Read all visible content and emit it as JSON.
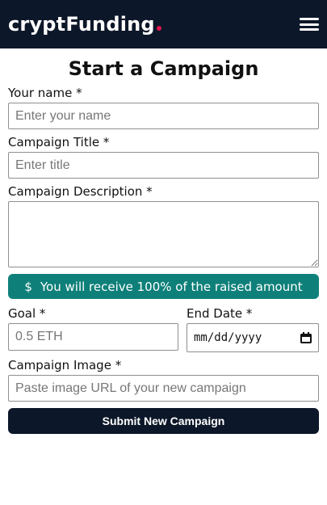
{
  "navbar": {
    "brand": "cryptFunding",
    "brand_dot_color": "#e0164f",
    "menu_icon": "hamburger-menu-icon",
    "background": "#0c1729"
  },
  "page": {
    "title": "Start a Campaign"
  },
  "form": {
    "name_label": "Your name *",
    "name_placeholder": "Enter your name",
    "title_label": "Campaign Title *",
    "title_placeholder": "Enter title",
    "description_label": "Campaign Description *",
    "banner_icon": "$",
    "banner_text": "You will receive 100% of the raised amount",
    "banner_color": "#0e8079",
    "goal_label": "Goal *",
    "goal_placeholder": "0.5 ETH",
    "end_date_label": "End Date *",
    "end_date_placeholder": "mm/dd/yyyy",
    "image_label": "Campaign Image *",
    "image_placeholder": "Paste image URL of your new campaign",
    "submit_label": "Submit New Campaign"
  }
}
